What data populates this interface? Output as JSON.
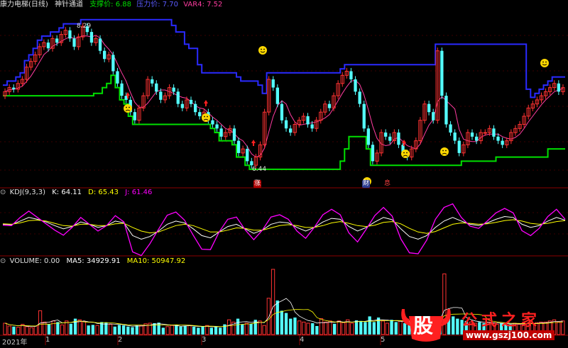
{
  "colors": {
    "background": "#000000",
    "up": "#ff3232",
    "down": "#54ffff",
    "support": "#00e000",
    "pressure": "#2a2aff",
    "panel_border": "#8b0000",
    "kdj_k": "#ffffff",
    "kdj_d": "#ffff00",
    "kdj_j": "#ff00ff"
  },
  "main_panel": {
    "title": "康力电梯(日线)",
    "indicator_name": "神针通道",
    "support_label": "支撑价:",
    "support_value": "6.88",
    "pressure_label": "压力价:",
    "pressure_value": "7.70",
    "var4_label": "VAR4:",
    "var4_value": "7.52",
    "high_label": "8.29",
    "low_label": "6.44",
    "badges": [
      "涨",
      "财",
      "息"
    ]
  },
  "kdj_panel": {
    "title": "KDJ(9,3,3)",
    "k": "K: 64.11",
    "d": "D: 65.43",
    "j": "J: 61.46"
  },
  "volume_panel": {
    "title": "VOLUME: 0.00",
    "ma5": "MA5: 34929.91",
    "ma10": "MA10: 50947.92"
  },
  "x_axis": {
    "ticks": [
      "2021年",
      "1",
      "2",
      "3",
      "4",
      "5"
    ]
  },
  "watermark": {
    "glyph": "股",
    "site": "公式之家",
    "url": "www.gszj100.com"
  },
  "chart_data": [
    {
      "type": "candlestick",
      "title": "康力电梯(日线)",
      "ylim": [
        6.3,
        8.45
      ],
      "annotations": {
        "high": 8.29,
        "low": 6.44
      },
      "last_values": {
        "support": 6.88,
        "pressure": 7.7,
        "var4": 7.52
      },
      "closes": [
        7.45,
        7.5,
        7.48,
        7.55,
        7.6,
        7.75,
        7.82,
        7.9,
        8.0,
        8.05,
        7.98,
        8.1,
        8.05,
        8.15,
        8.2,
        8.1,
        8.0,
        8.12,
        8.25,
        8.18,
        8.05,
        8.1,
        7.95,
        7.85,
        7.9,
        7.7,
        7.55,
        7.4,
        7.35,
        7.2,
        7.1,
        7.25,
        7.4,
        7.6,
        7.55,
        7.45,
        7.35,
        7.4,
        7.5,
        7.45,
        7.3,
        7.25,
        7.35,
        7.3,
        7.2,
        7.15,
        7.2,
        7.1,
        7.05,
        7.0,
        6.9,
        6.95,
        7.0,
        6.85,
        6.7,
        6.75,
        6.6,
        6.55,
        6.65,
        6.8,
        7.2,
        7.6,
        7.5,
        7.3,
        7.1,
        7.0,
        6.95,
        7.05,
        7.1,
        7.15,
        7.05,
        7.0,
        7.1,
        7.2,
        7.3,
        7.25,
        7.4,
        7.55,
        7.65,
        7.7,
        7.6,
        7.45,
        7.3,
        7.0,
        6.8,
        6.6,
        6.7,
        6.95,
        6.9,
        6.85,
        6.95,
        6.8,
        6.7,
        6.65,
        6.75,
        6.85,
        7.1,
        7.3,
        7.2,
        7.1,
        7.95,
        7.4,
        7.05,
        6.95,
        6.85,
        6.7,
        6.8,
        6.95,
        6.9,
        6.85,
        6.95,
        6.95,
        7.0,
        6.9,
        6.85,
        6.8,
        6.85,
        6.95,
        7.0,
        7.05,
        7.15,
        7.25,
        7.3,
        7.35,
        7.4,
        7.45,
        7.5,
        7.55,
        7.45,
        7.5
      ]
    },
    {
      "type": "line",
      "title": "KDJ(9,3,3)",
      "ylim": [
        -10,
        115
      ],
      "series": [
        {
          "name": "K",
          "last": 64.11,
          "values": [
            55,
            54,
            62,
            70,
            66,
            60,
            52,
            45,
            50,
            60,
            55,
            48,
            52,
            62,
            58,
            30,
            22,
            28,
            40,
            55,
            62,
            58,
            45,
            30,
            25,
            38,
            50,
            55,
            45,
            35,
            42,
            55,
            60,
            58,
            48,
            40,
            48,
            60,
            68,
            66,
            50,
            40,
            48,
            60,
            70,
            65,
            45,
            28,
            22,
            30,
            48,
            62,
            70,
            62,
            55,
            52,
            58,
            66,
            72,
            70,
            55,
            48,
            52,
            62,
            70,
            64
          ]
        },
        {
          "name": "D",
          "last": 65.43,
          "values": [
            56,
            55,
            58,
            63,
            64,
            62,
            57,
            52,
            51,
            55,
            55,
            52,
            52,
            56,
            57,
            48,
            40,
            36,
            38,
            45,
            52,
            55,
            52,
            45,
            38,
            38,
            42,
            47,
            46,
            42,
            42,
            47,
            52,
            54,
            52,
            48,
            48,
            52,
            58,
            61,
            57,
            52,
            50,
            53,
            59,
            61,
            56,
            46,
            38,
            35,
            39,
            47,
            55,
            58,
            57,
            55,
            56,
            59,
            63,
            65,
            62,
            57,
            55,
            57,
            61,
            63
          ]
        },
        {
          "name": "J",
          "last": 61.46,
          "values": [
            53,
            52,
            70,
            84,
            70,
            56,
            42,
            31,
            48,
            70,
            55,
            40,
            52,
            74,
            60,
            -6,
            -14,
            12,
            44,
            75,
            82,
            64,
            31,
            0,
            -1,
            38,
            66,
            71,
            43,
            21,
            42,
            71,
            76,
            66,
            40,
            24,
            48,
            76,
            88,
            76,
            36,
            16,
            44,
            74,
            92,
            73,
            23,
            -8,
            -10,
            20,
            66,
            92,
            100,
            70,
            51,
            46,
            62,
            80,
            90,
            80,
            41,
            30,
            46,
            72,
            88,
            66
          ]
        }
      ]
    },
    {
      "type": "bar",
      "title": "VOLUME",
      "ylim": [
        0,
        120000
      ],
      "series": [
        {
          "name": "VOLUME",
          "values": [
            20000,
            15000,
            14000,
            13000,
            18000,
            14000,
            12000,
            15000,
            42000,
            22000,
            18000,
            24000,
            22000,
            17000,
            24000,
            19000,
            28000,
            26000,
            23000,
            16000,
            17000,
            16000,
            22000,
            21000,
            18000,
            14000,
            17000,
            16000,
            14000,
            13000,
            16000,
            16000,
            19000,
            20000,
            20000,
            21000,
            12000,
            14000,
            16000,
            17000,
            14000,
            15000,
            16000,
            14000,
            12000,
            15000,
            16000,
            12000,
            14000,
            12000,
            18000,
            26000,
            22000,
            28000,
            18000,
            20000,
            19000,
            26000,
            24000,
            16000,
            64000,
            115000,
            60000,
            42000,
            38000,
            28000,
            30000,
            24000,
            22000,
            20000,
            20000,
            15000,
            28000,
            22000,
            24000,
            19000,
            24000,
            21000,
            26000,
            20000,
            25000,
            24000,
            22000,
            32000,
            22000,
            30000,
            24000,
            20000,
            26000,
            22000,
            24000,
            20000,
            24000,
            27000,
            24000,
            22000,
            26000,
            22000,
            28000,
            31000,
            107000,
            40000,
            32000,
            28000,
            26000,
            24000,
            22000,
            20000,
            22000,
            20000,
            22000,
            20000,
            18000,
            20000,
            18000,
            18000,
            20000,
            18000,
            20000,
            19000,
            20000,
            21000,
            22000,
            22000,
            24000,
            26000,
            22000,
            24000
          ]
        },
        {
          "name": "MA5",
          "last": 34929.91
        },
        {
          "name": "MA10",
          "last": 50947.92
        }
      ]
    }
  ]
}
